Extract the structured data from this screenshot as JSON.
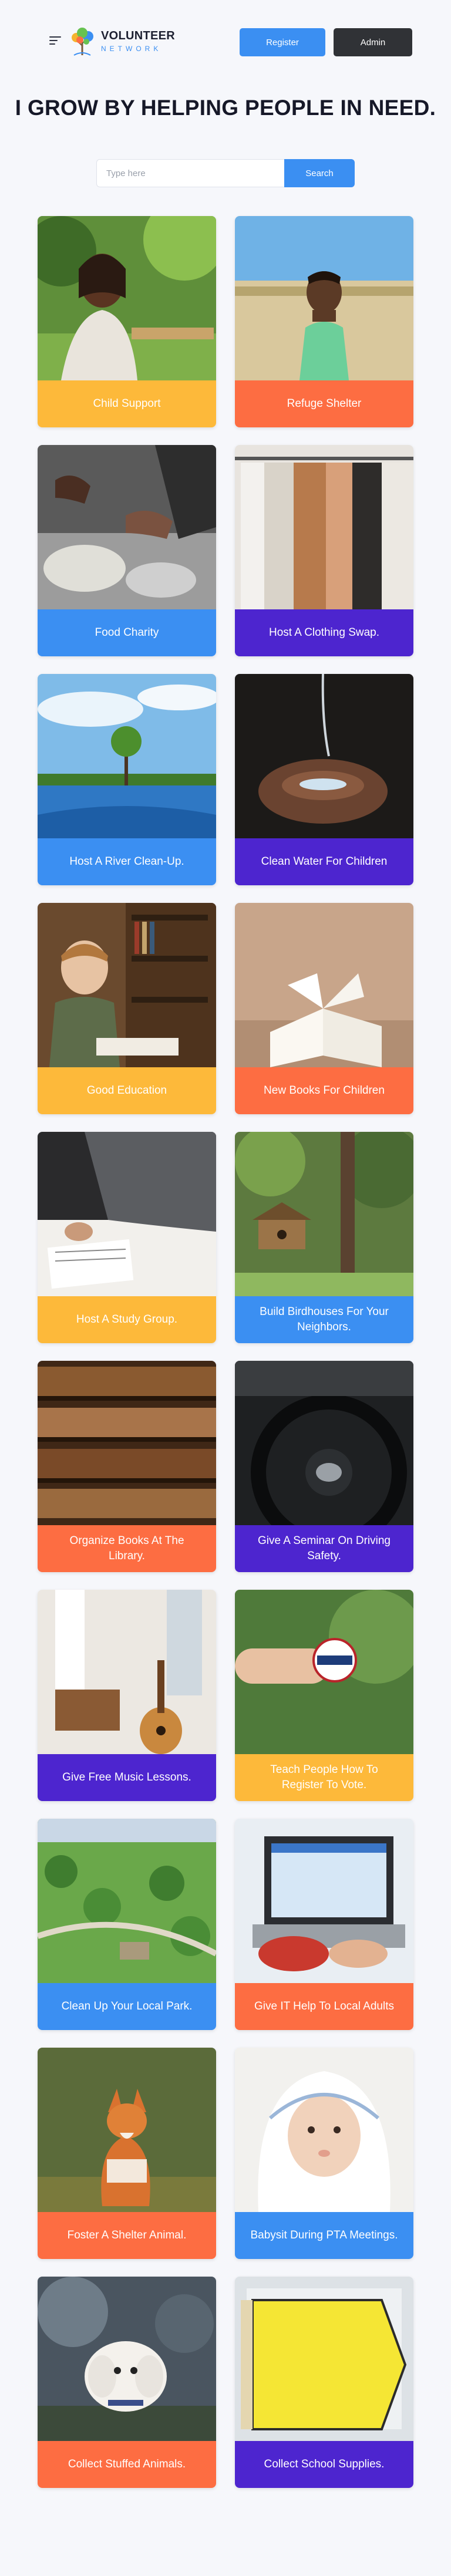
{
  "header": {
    "logo": {
      "title": "VOLUNTEER",
      "subtitle": "NETWORK"
    },
    "register_label": "Register",
    "admin_label": "Admin"
  },
  "hero": {
    "title": "I GROW BY HELPING PEOPLE IN NEED."
  },
  "search": {
    "placeholder": "Type here",
    "button_label": "Search"
  },
  "colors": {
    "accent": "#3b8ff2",
    "yellow": "#fdb93a",
    "orange": "#fd6d42",
    "purple": "#4d25cf",
    "blue": "#3b8ff2",
    "dark": "#303236"
  },
  "cards": [
    {
      "label": "Child Support",
      "color": "#fdb93a",
      "image": "girl-in-garden"
    },
    {
      "label": "Refuge Shelter",
      "color": "#fd6d42",
      "image": "boy-in-field"
    },
    {
      "label": "Food Charity",
      "color": "#3b8ff2",
      "image": "food-donation"
    },
    {
      "label": "Host A Clothing Swap.",
      "color": "#4d25cf",
      "image": "clothing-rack"
    },
    {
      "label": "Host A River Clean-Up.",
      "color": "#3b8ff2",
      "image": "river-landscape"
    },
    {
      "label": "Clean Water For Children",
      "color": "#4d25cf",
      "image": "water-in-hands"
    },
    {
      "label": "Good Education",
      "color": "#fdb93a",
      "image": "boy-reading"
    },
    {
      "label": "New Books For Children",
      "color": "#fd6d42",
      "image": "open-book"
    },
    {
      "label": "Host A Study Group.",
      "color": "#fdb93a",
      "image": "study-notes"
    },
    {
      "label": "Build Birdhouses For Your Neighbors.",
      "color": "#3b8ff2",
      "image": "birdhouse"
    },
    {
      "label": "Organize Books At The Library.",
      "color": "#fd6d42",
      "image": "library-shelves"
    },
    {
      "label": "Give A Seminar On Driving Safety.",
      "color": "#4d25cf",
      "image": "steering-wheel"
    },
    {
      "label": "Give Free Music Lessons.",
      "color": "#4d25cf",
      "image": "guitar-room"
    },
    {
      "label": "Teach People How To Register To Vote.",
      "color": "#fdb93a",
      "image": "i-voted-sticker"
    },
    {
      "label": "Clean Up Your Local Park.",
      "color": "#3b8ff2",
      "image": "aerial-park"
    },
    {
      "label": "Give IT Help To Local Adults",
      "color": "#fd6d42",
      "image": "laptop-typing"
    },
    {
      "label": "Foster A Shelter Animal.",
      "color": "#fd6d42",
      "image": "red-fox"
    },
    {
      "label": "Babysit During PTA Meetings.",
      "color": "#3b8ff2",
      "image": "baby-in-towel"
    },
    {
      "label": "Collect Stuffed Animals.",
      "color": "#fd6d42",
      "image": "white-puppy"
    },
    {
      "label": "Collect School Supplies.",
      "color": "#4d25cf",
      "image": "love-to-learn-sign"
    }
  ]
}
